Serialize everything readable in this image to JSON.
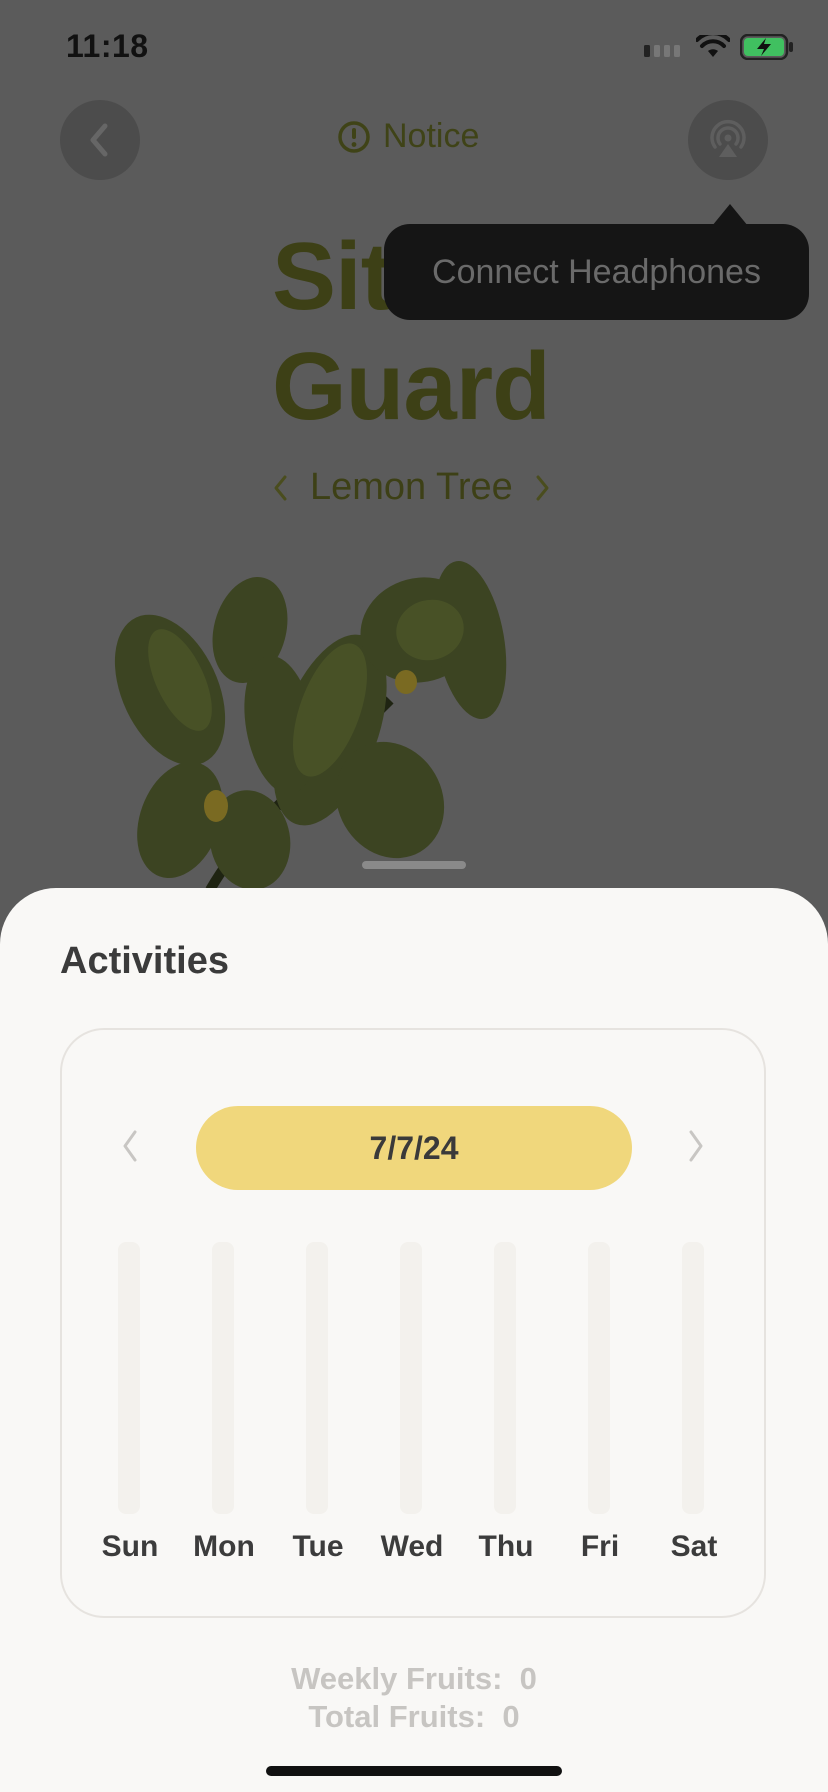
{
  "status_bar": {
    "time": "11:18"
  },
  "header": {
    "notice_label": "Notice"
  },
  "hero": {
    "title_line1": "Sit",
    "title_line2": "Guard",
    "tree_name": "Lemon Tree"
  },
  "tooltip": {
    "text": "Connect Headphones"
  },
  "sheet": {
    "title": "Activities",
    "date": "7/7/24",
    "days": [
      "Sun",
      "Mon",
      "Tue",
      "Wed",
      "Thu",
      "Fri",
      "Sat"
    ],
    "weekly_label": "Weekly Fruits:",
    "weekly_value": "0",
    "total_label": "Total Fruits:",
    "total_value": "0"
  },
  "colors": {
    "accent_pill": "#f0d77c",
    "sheet_bg": "#f9f8f6",
    "overlay": "#5b5b5b",
    "tooltip_bg": "#151515",
    "title_dark_green": "#3d4016"
  }
}
